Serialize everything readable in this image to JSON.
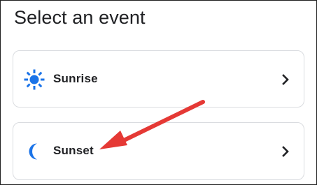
{
  "page": {
    "title": "Select an event"
  },
  "events": [
    {
      "label": "Sunrise",
      "icon": "sunrise-sun-icon"
    },
    {
      "label": "Sunset",
      "icon": "sunset-moon-icon"
    }
  ],
  "colors": {
    "accent_blue": "#1a73e8",
    "text": "#202124",
    "card_border": "#dadce0",
    "annotation_arrow": "#e53935"
  }
}
